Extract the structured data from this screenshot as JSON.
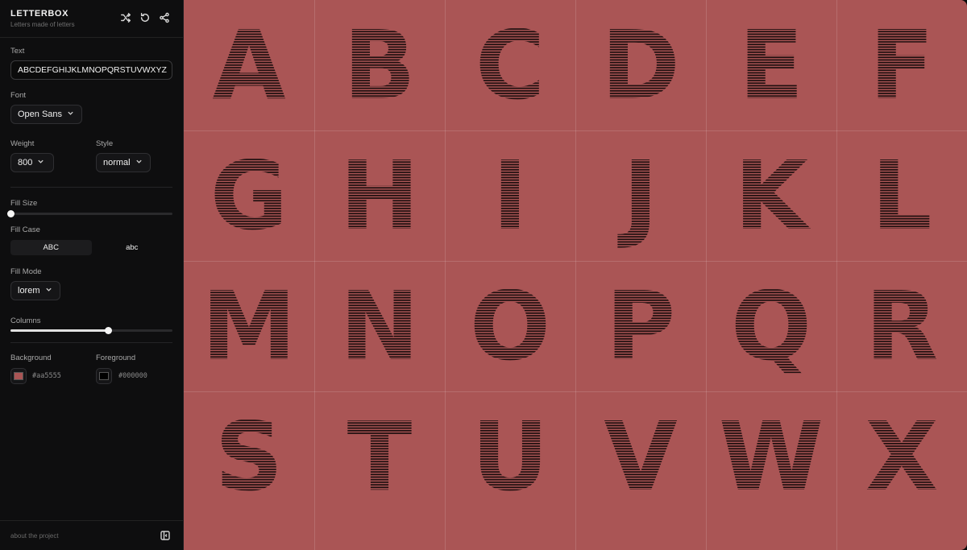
{
  "app": {
    "title": "LETTERBOX",
    "subtitle": "Letters made of letters"
  },
  "header": {
    "icons": [
      "shuffle-icon",
      "reset-icon",
      "share-icon"
    ]
  },
  "controls": {
    "text_label": "Text",
    "text_value": "ABCDEFGHIJKLMNOPQRSTUVWXYZ",
    "font_label": "Font",
    "font_value": "Open Sans",
    "weight_label": "Weight",
    "weight_value": "800",
    "style_label": "Style",
    "style_value": "normal",
    "fill_size_label": "Fill Size",
    "fill_size_level": 0.0,
    "fill_case_label": "Fill Case",
    "fill_case_options": [
      "ABC",
      "abc"
    ],
    "fill_case_selected": "ABC",
    "fill_mode_label": "Fill Mode",
    "fill_mode_value": "lorem",
    "columns_label": "Columns",
    "columns_level": 0.6,
    "background_label": "Background",
    "background_hex": "#aa5555",
    "foreground_label": "Foreground",
    "foreground_hex": "#000000"
  },
  "footer": {
    "about_label": "about the project"
  },
  "canvas": {
    "background": "#aa5555",
    "foreground": "#000000",
    "letters": [
      "A",
      "B",
      "C",
      "D",
      "E",
      "F",
      "G",
      "H",
      "I",
      "J",
      "K",
      "L",
      "M",
      "N",
      "O",
      "P",
      "Q",
      "R",
      "S",
      "T",
      "U",
      "V",
      "W",
      "X"
    ]
  }
}
